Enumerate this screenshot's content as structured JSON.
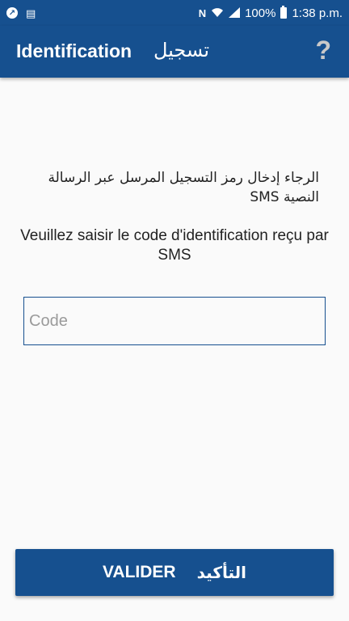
{
  "status_bar": {
    "battery_percent": "100%",
    "time": "1:38 p.m.",
    "icons": [
      "notification-icon",
      "sim-icon",
      "nfc-icon",
      "wifi-icon",
      "signal-icon",
      "battery-icon"
    ]
  },
  "app_bar": {
    "title": "Identification",
    "title_ar": "تسجيل",
    "help_symbol": "?"
  },
  "main": {
    "message_ar": "الرجاء إدخال رمز التسجيل المرسل عبر الرسالة النصية SMS",
    "message_fr": "Veuillez saisir le code d'identification reçu par SMS",
    "code_input": {
      "value": "",
      "placeholder": "Code"
    }
  },
  "footer": {
    "validate_label": "VALIDER",
    "validate_label_ar": "التأكيد"
  },
  "colors": {
    "primary": "#16508f",
    "background": "#fafafa"
  }
}
